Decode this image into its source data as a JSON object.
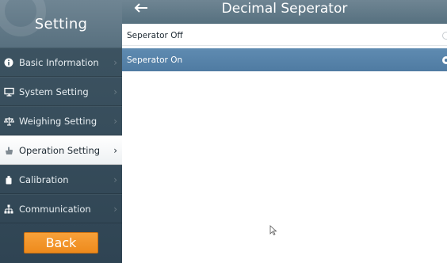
{
  "sidebar": {
    "title": "Setting",
    "items": [
      {
        "label": "Basic Information",
        "icon": "info-icon"
      },
      {
        "label": "System Setting",
        "icon": "monitor-icon"
      },
      {
        "label": "Weighing Setting",
        "icon": "scale-icon"
      },
      {
        "label": "Operation Setting",
        "icon": "hand-icon",
        "active": true
      },
      {
        "label": "Calibration",
        "icon": "weight-icon"
      },
      {
        "label": "Communication",
        "icon": "network-icon"
      }
    ],
    "back_label": "Back"
  },
  "header": {
    "title": "Decimal Seperator"
  },
  "options": [
    {
      "label": "Seperator Off",
      "selected": false
    },
    {
      "label": "Seperator On",
      "selected": true
    }
  ],
  "colors": {
    "sidebar_bg": "#3f5664",
    "header_bg": "#6f8593",
    "selected_row": "#5a86ad",
    "back_button": "#f39a2e"
  }
}
